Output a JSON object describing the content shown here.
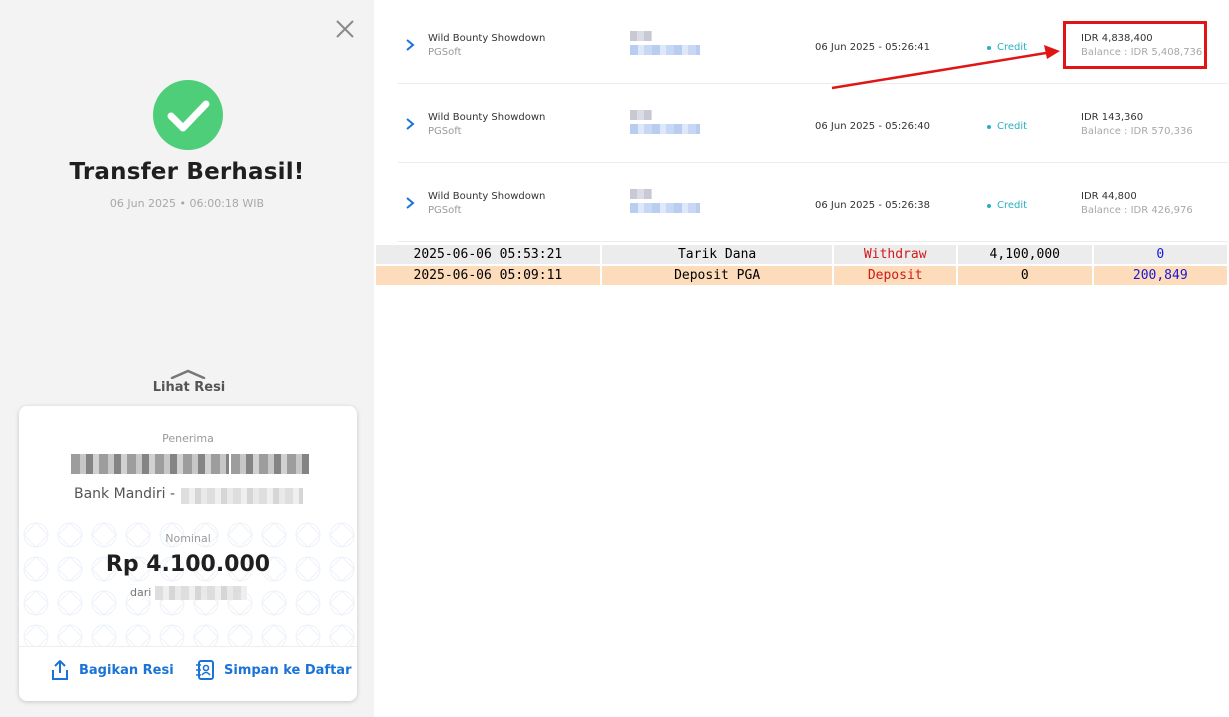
{
  "left_panel": {
    "title": "Transfer Berhasil!",
    "datetime": "06 Jun 2025 • 06:00:18 WIB",
    "view_receipt_label": "Lihat Resi",
    "receipt": {
      "recipient_label": "Penerima",
      "bank_prefix": "Bank Mandiri -",
      "amount_label": "Nominal",
      "amount": "Rp 4.100.000",
      "from_prefix": "dari",
      "share_label": "Bagikan Resi",
      "save_label": "Simpan ke Daftar"
    },
    "accent_color": "#1a73d9",
    "success_color": "#4fce79"
  },
  "transactions": [
    {
      "game": "Wild Bounty Showdown",
      "provider": "PGSoft",
      "datetime": "06 Jun 2025 - 05:26:41",
      "status": "Credit",
      "amount": "IDR 4,838,400",
      "balance": "Balance : IDR 5,408,736"
    },
    {
      "game": "Wild Bounty Showdown",
      "provider": "PGSoft",
      "datetime": "06 Jun 2025 - 05:26:40",
      "status": "Credit",
      "amount": "IDR 143,360",
      "balance": "Balance : IDR 570,336"
    },
    {
      "game": "Wild Bounty Showdown",
      "provider": "PGSoft",
      "datetime": "06 Jun 2025 - 05:26:38",
      "status": "Credit",
      "amount": "IDR 44,800",
      "balance": "Balance : IDR 426,976"
    }
  ],
  "history_table": {
    "rows": [
      [
        "2025-06-06 05:53:21",
        "Tarik Dana",
        "Withdraw",
        "4,100,000",
        "0"
      ],
      [
        "2025-06-06 05:09:11",
        "Deposit PGA",
        "Deposit",
        "0",
        "200,849"
      ]
    ]
  },
  "annotation_color": "#e01515"
}
